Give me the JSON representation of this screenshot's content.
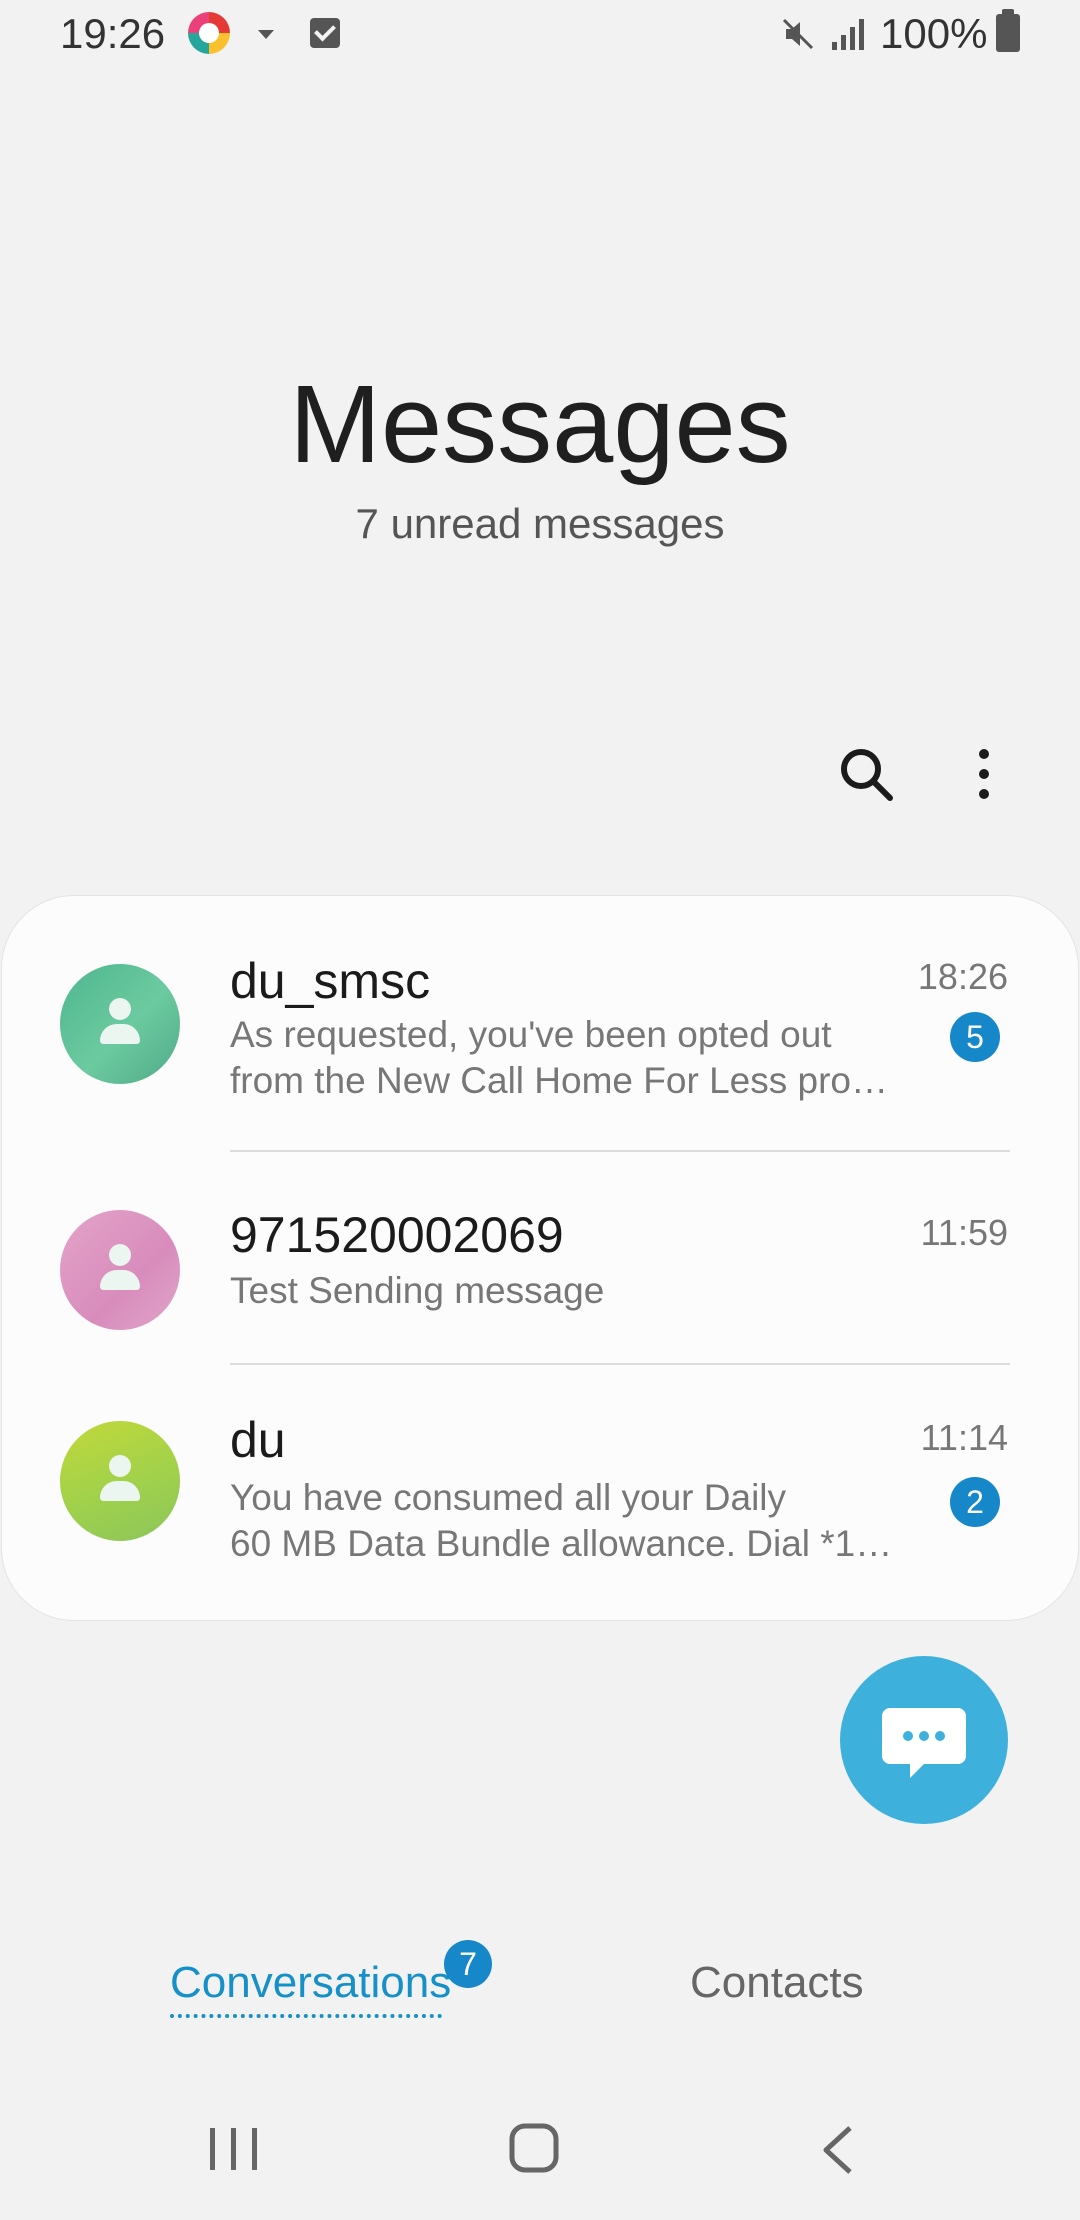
{
  "status_bar": {
    "time": "19:26",
    "battery": "100%"
  },
  "header": {
    "title": "Messages",
    "subtitle": "7 unread messages"
  },
  "actions": {
    "search_icon": "search-icon",
    "more_icon": "more-vert-icon"
  },
  "conversations": [
    {
      "name": "du_smsc",
      "time": "18:26",
      "snippet_line1": "As requested, you've been opted out",
      "snippet_line2": "from the New Call Home For Less pro…",
      "unread": "5",
      "avatar_color": "#5bbf95"
    },
    {
      "name": "971520002069",
      "time": "11:59",
      "snippet_line1": "Test Sending message",
      "avatar_color": "#d98fbf"
    },
    {
      "name": "du",
      "time": "11:14",
      "snippet_line1": "You have consumed all your Daily",
      "snippet_line2": "60 MB Data Bundle allowance. Dial *1…",
      "unread": "2",
      "avatar_color": "#a4d448"
    }
  ],
  "fab": {
    "icon": "compose-message-icon",
    "color": "#3eb0dc"
  },
  "tabs": {
    "conversations": "Conversations",
    "conversations_badge": "7",
    "contacts": "Contacts"
  },
  "colors": {
    "accent": "#1590c9",
    "badge": "#1687c8"
  }
}
